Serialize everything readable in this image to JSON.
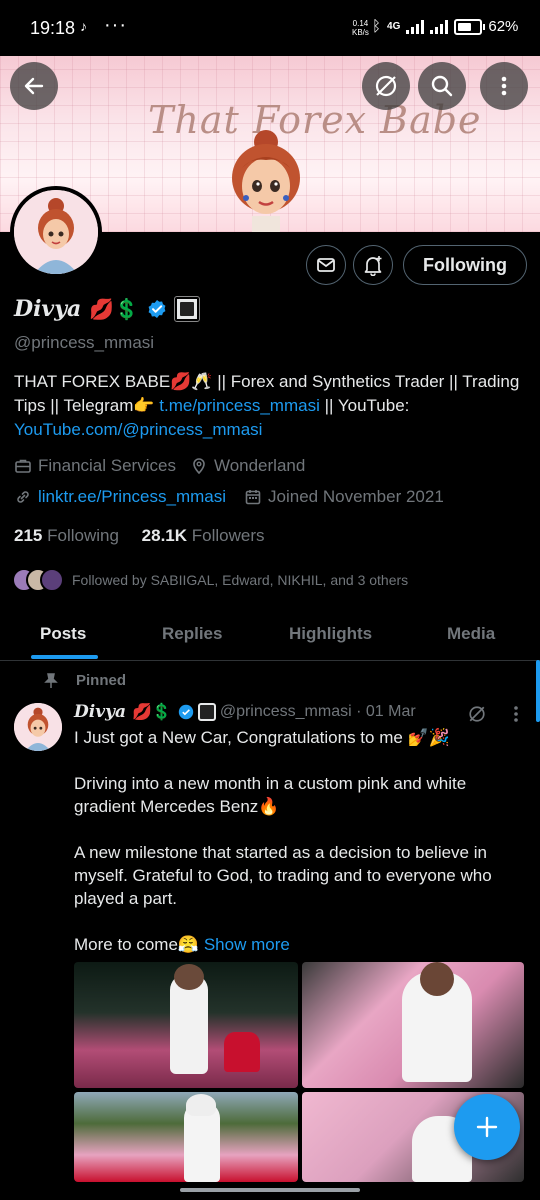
{
  "status_bar": {
    "time": "19:18",
    "net_speed_value": "0.14",
    "net_speed_unit": "KB/s",
    "network": "4G",
    "battery": "62%"
  },
  "banner": {
    "title_text": "That Forex Babe"
  },
  "actions": {
    "following_label": "Following"
  },
  "profile": {
    "name": "Divya",
    "name_emojis": "💋💲",
    "handle": "@princess_mmasi",
    "bio_part1": "THAT FOREX BABE💋🥂 || Forex and Synthetics Trader || Trading Tips || Telegram👉 ",
    "bio_link1": "t.me/princess_mmasi",
    "bio_part2": " || YouTube: ",
    "bio_link2": "YouTube.com/@princess_mmasi",
    "category": "Financial Services",
    "location": "Wonderland",
    "website": "linktr.ee/Princess_mmasi",
    "joined": "Joined November 2021",
    "following_count": "215",
    "following_label": "Following",
    "followers_count": "28.1K",
    "followers_label": "Followers",
    "followed_by": "Followed by SABIIGAL, Edward, NIKHIL, and 3 others"
  },
  "tabs": [
    {
      "label": "Posts"
    },
    {
      "label": "Replies"
    },
    {
      "label": "Highlights"
    },
    {
      "label": "Media"
    }
  ],
  "tweet": {
    "pinned_label": "Pinned",
    "name": "Divya",
    "name_emojis": "💋💲",
    "handle_date": "@princess_mmasi · 01 Mar",
    "text": "I Just got a New Car, Congratulations to me 💅🎉\n\nDriving into a new month in a custom pink and white gradient Mercedes Benz🔥\n\nA new milestone that started as a decision to believe in myself. Grateful to God, to trading and to everyone who played a part.\n\nMore to come😤",
    "show_more": "Show more"
  },
  "icons": {
    "back": "back-arrow-icon",
    "grok": "grok-icon",
    "search": "search-icon",
    "more": "more-vertical-icon",
    "message": "message-icon",
    "notify": "notification-bell-icon",
    "compose": "compose-plus-icon"
  },
  "colors": {
    "accent": "#1d9bf0",
    "background": "#000000",
    "secondary_text": "#71767b"
  }
}
